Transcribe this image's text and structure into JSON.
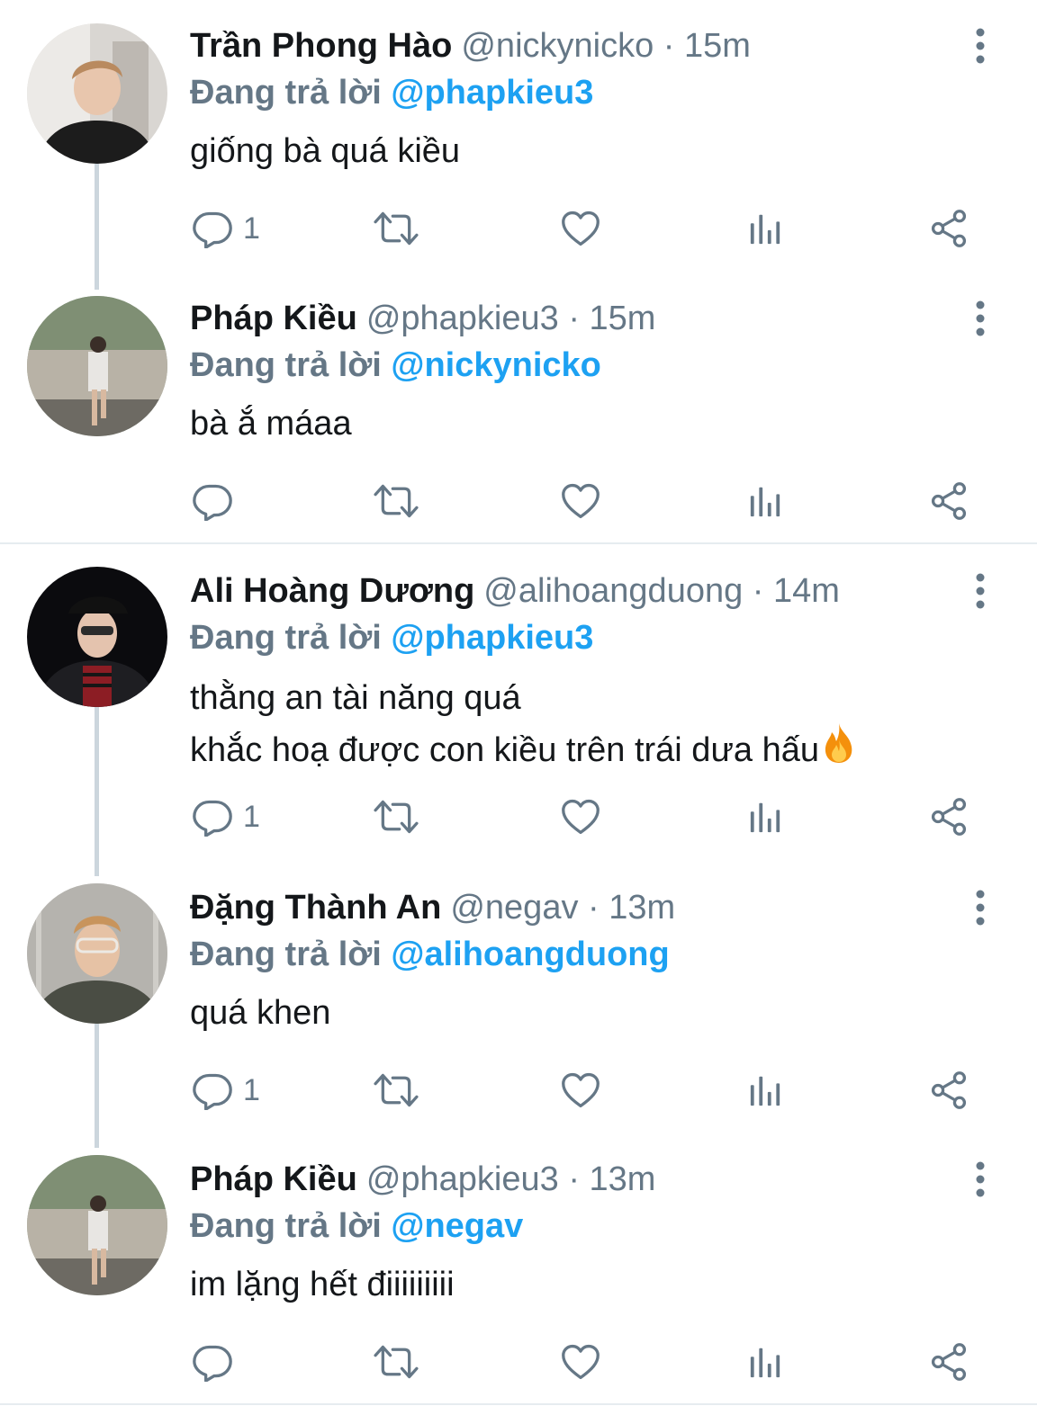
{
  "colors": {
    "text_primary": "#14171a",
    "text_secondary": "#657786",
    "link": "#1da1f2",
    "divider": "#e6ecf0",
    "connector": "#ccd6dd",
    "icon": "#657786"
  },
  "reply_prefix": "Đang trả lời",
  "threads": [
    {
      "tweets": [
        {
          "display_name": "Trần Phong Hào",
          "meta": "@nickynicko · 15m",
          "reply_to": "@phapkieu3",
          "text_lines": [
            "giống bà quá kiều"
          ],
          "reply_count": "1",
          "avatar_icon": "avatar-photo-icon"
        },
        {
          "display_name": "Pháp Kiều",
          "meta": "@phapkieu3 · 15m",
          "reply_to": "@nickynicko",
          "text_lines": [
            "bà ắ máaa"
          ],
          "reply_count": "",
          "avatar_icon": "avatar-photo-icon"
        }
      ]
    },
    {
      "tweets": [
        {
          "display_name": "Ali Hoàng Dương",
          "meta": "@alihoangduong · 14m",
          "reply_to": "@phapkieu3",
          "text_lines": [
            "thằng an tài năng quá",
            "khắc hoạ được con kiều trên trái dưa hấu"
          ],
          "reply_count": "1",
          "avatar_icon": "avatar-photo-icon",
          "emoji": "fire-emoji"
        },
        {
          "display_name": "Đặng Thành An",
          "meta": "@negav · 13m",
          "reply_to": "@alihoangduong",
          "text_lines": [
            "quá khen"
          ],
          "reply_count": "1",
          "avatar_icon": "avatar-photo-icon"
        },
        {
          "display_name": "Pháp Kiều",
          "meta": "@phapkieu3 · 13m",
          "reply_to": "@negav",
          "text_lines": [
            "im lặng hết điiiiiiiii"
          ],
          "reply_count": "",
          "avatar_icon": "avatar-photo-icon"
        }
      ]
    }
  ]
}
